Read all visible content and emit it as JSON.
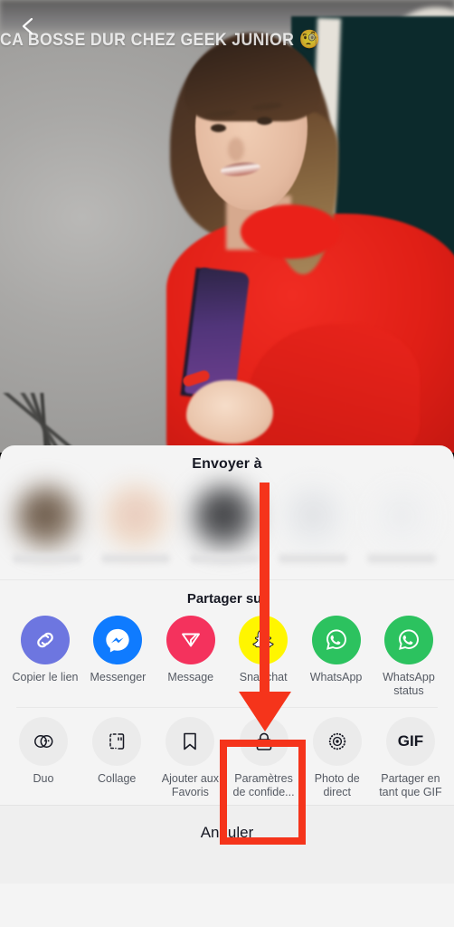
{
  "video": {
    "caption_text": "CA BOSSE DUR CHEZ GEEK JUNIOR",
    "caption_emoji": "🧐",
    "back_icon": "back-chevron-icon"
  },
  "sheet": {
    "send_to_title": "Envoyer à",
    "contacts": [
      {
        "name_hidden": ""
      },
      {
        "name_hidden": ""
      },
      {
        "name_hidden": ""
      },
      {
        "name_hidden": ""
      },
      {
        "name_hidden": ""
      }
    ],
    "share_title": "Partager sur",
    "share_targets": [
      {
        "label": "Copier le lien",
        "icon": "link-icon",
        "color": "#6d76e0"
      },
      {
        "label": "Messenger",
        "icon": "messenger-icon",
        "color": "#0f7bff"
      },
      {
        "label": "Message",
        "icon": "send-message-icon",
        "color": "#f4325d"
      },
      {
        "label": "Snapchat",
        "icon": "snapchat-ghost-icon",
        "color": "#fff600"
      },
      {
        "label": "WhatsApp",
        "icon": "whatsapp-icon",
        "color": "#2cc25f"
      },
      {
        "label": "WhatsApp status",
        "icon": "whatsapp-status-icon",
        "color": "#2cc25f"
      }
    ],
    "actions": [
      {
        "label": "Duo",
        "icon": "duo-icon"
      },
      {
        "label": "Collage",
        "icon": "collage-icon"
      },
      {
        "label": "Ajouter aux Favoris",
        "icon": "bookmark-icon"
      },
      {
        "label": "Paramètres de confide...",
        "icon": "lock-icon"
      },
      {
        "label": "Photo de direct",
        "icon": "live-photo-icon"
      },
      {
        "label": "Partager en tant que GIF",
        "icon": "gif-icon"
      }
    ],
    "cancel_label": "Annuler"
  },
  "annotation": {
    "arrow_color": "#f5341b",
    "highlight_color": "#f5341b",
    "highlight_target": "Paramètres de confide..."
  }
}
